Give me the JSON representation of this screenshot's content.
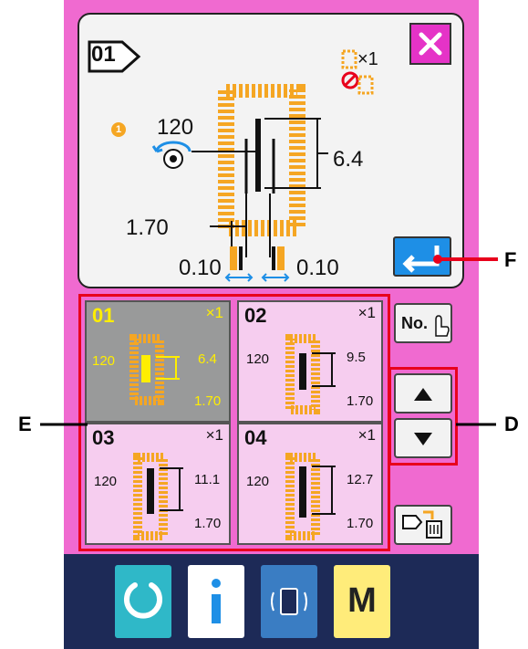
{
  "pattern": {
    "number": "01",
    "thread_tension": "120",
    "dimension_right": "6.4",
    "dimension_left": "1.70",
    "clamp_left": "0.10",
    "clamp_right": "0.10",
    "repeat_label": "×1",
    "status_number": "1"
  },
  "pattern_list": [
    {
      "number": "01",
      "repeat": "×1",
      "tension": "120",
      "size": "6.4",
      "width": "1.70"
    },
    {
      "number": "02",
      "repeat": "×1",
      "tension": "120",
      "size": "9.5",
      "width": "1.70"
    },
    {
      "number": "03",
      "repeat": "×1",
      "tension": "120",
      "size": "11.1",
      "width": "1.70"
    },
    {
      "number": "04",
      "repeat": "×1",
      "tension": "120",
      "size": "12.7",
      "width": "1.70"
    }
  ],
  "buttons": {
    "no_label": "No.",
    "menu_label": "M"
  },
  "callouts": {
    "d": "D",
    "e": "E",
    "f": "F"
  },
  "icons": [
    "close-icon",
    "enter-icon",
    "up-arrow-icon",
    "down-arrow-icon",
    "copy-delete-icon",
    "reset-icon",
    "info-icon",
    "communication-icon"
  ],
  "colors": {
    "pink": "#f06ad0",
    "orange": "#f5a623",
    "blue": "#1e8fe6",
    "navy": "#1d2a57",
    "red": "#e8001c"
  }
}
